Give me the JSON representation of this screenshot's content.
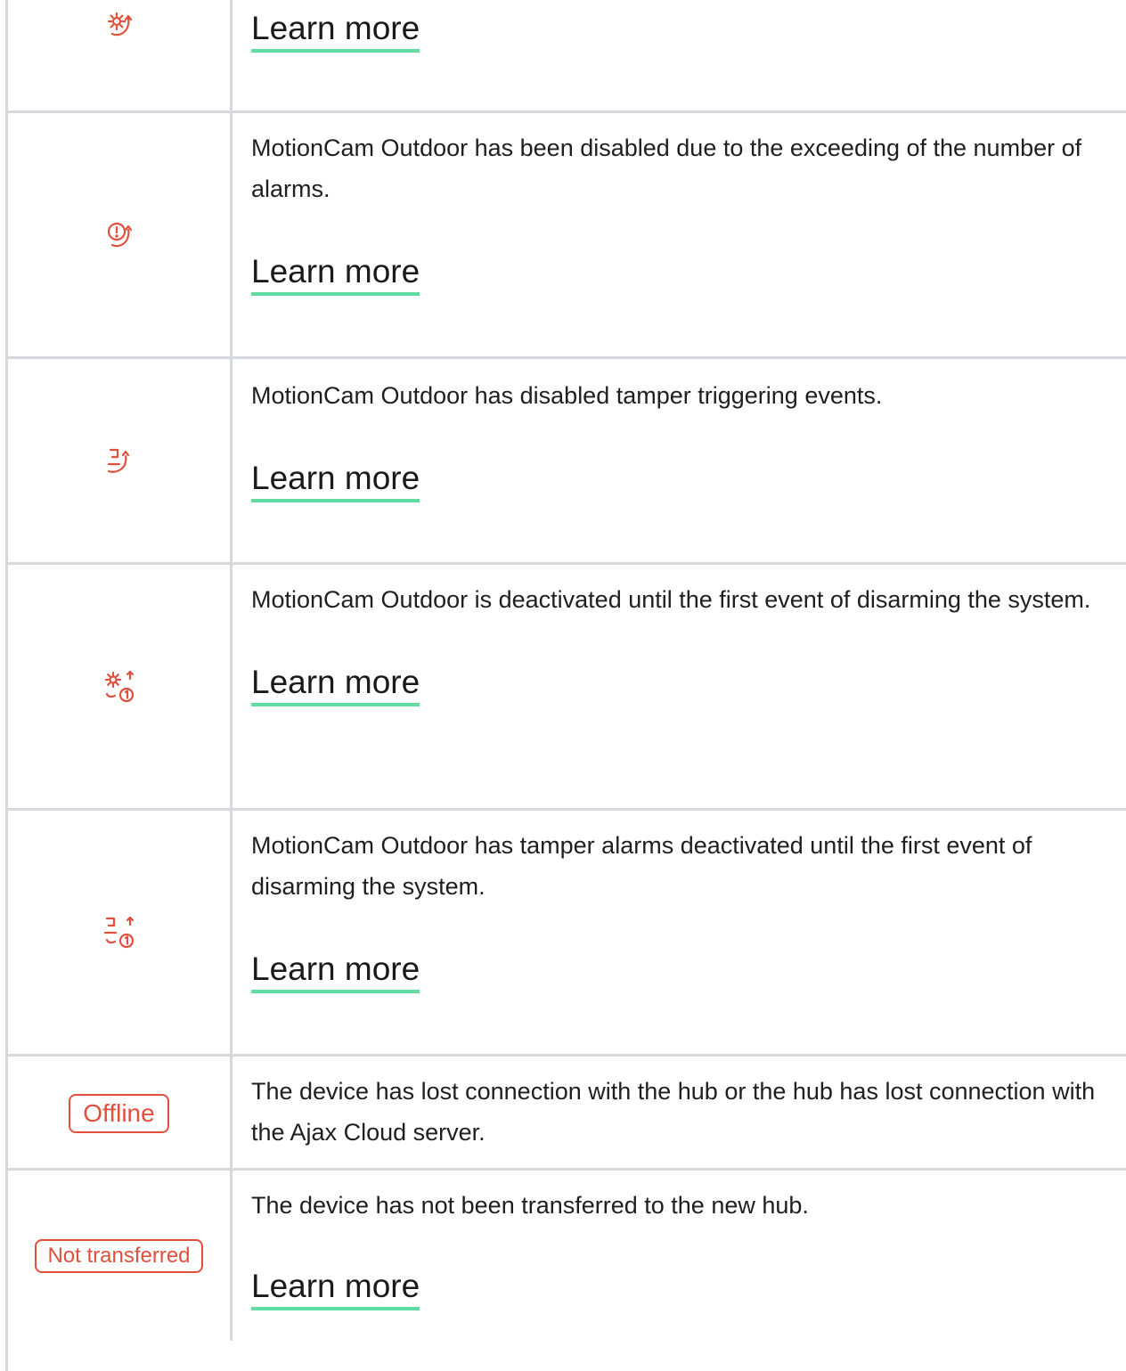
{
  "rows": [
    {
      "icon": "gear-rotate-icon",
      "learn_more": "Learn more"
    },
    {
      "icon": "alert-rotate-icon",
      "description": "MotionCam Outdoor has been disabled due to the exceeding of the number of alarms.",
      "learn_more": "Learn more"
    },
    {
      "icon": "tamper-rotate-icon",
      "description": "MotionCam Outdoor has disabled tamper triggering events.",
      "learn_more": "Learn more"
    },
    {
      "icon": "gear-once-icon",
      "description": "MotionCam Outdoor is deactivated until the first event of disarming the system.",
      "learn_more": "Learn more"
    },
    {
      "icon": "tamper-once-icon",
      "description": "MotionCam Outdoor has tamper alarms deactivated until the first event of disarming the system.",
      "learn_more": "Learn more"
    },
    {
      "badge": "Offline",
      "description": "The device has lost connection with the hub or the hub has lost connection with the Ajax Cloud server."
    },
    {
      "badge": "Not transferred",
      "description": "The device has not been transferred to the new hub.",
      "learn_more": "Learn more"
    }
  ],
  "colors": {
    "icon_red": "#e1503d",
    "underline_green": "#5fdca1",
    "grid": "#d5d8dc"
  }
}
